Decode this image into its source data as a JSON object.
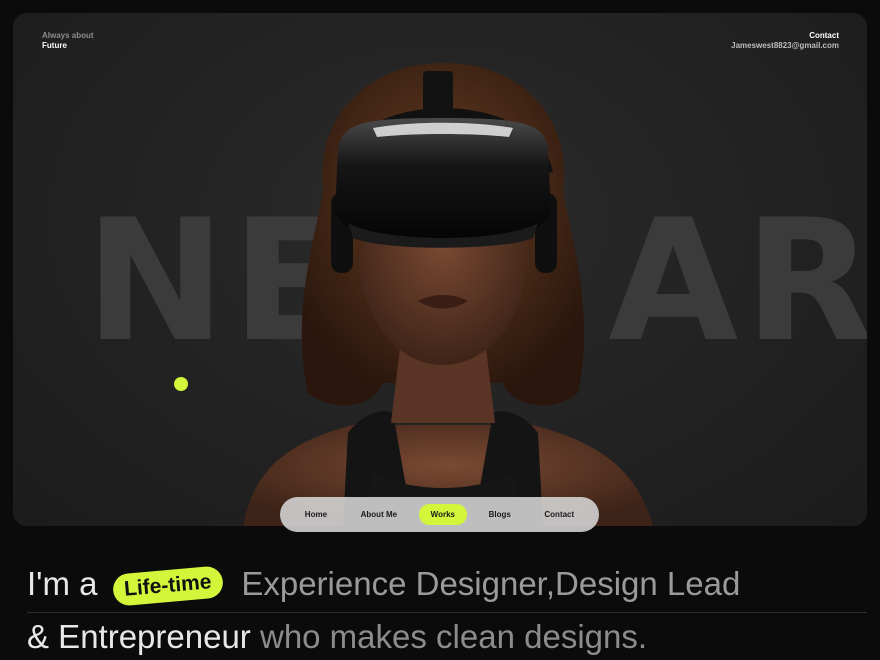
{
  "hero": {
    "tagline_muted": "Always about",
    "tagline_strong": "Future",
    "contact_label": "Contact",
    "contact_email": "Jameswest8823@gmail.com",
    "background_text": "NEW ART"
  },
  "nav": {
    "items": [
      {
        "label": "Home",
        "active": false
      },
      {
        "label": "About Me",
        "active": false
      },
      {
        "label": "Works",
        "active": true
      },
      {
        "label": "Blogs",
        "active": false
      },
      {
        "label": "Contact",
        "active": false
      }
    ]
  },
  "intro": {
    "line1_lead": "I'm a",
    "pill": "Life-time",
    "line1_rest": "Experience Designer,Design Lead",
    "line2_lead": "& Entrepreneur",
    "line2_rest": " who makes clean designs."
  },
  "colors": {
    "accent": "#d3f53a",
    "background": "#0b0b0b",
    "card": "#222222"
  },
  "icons": [
    "accent-dot"
  ]
}
